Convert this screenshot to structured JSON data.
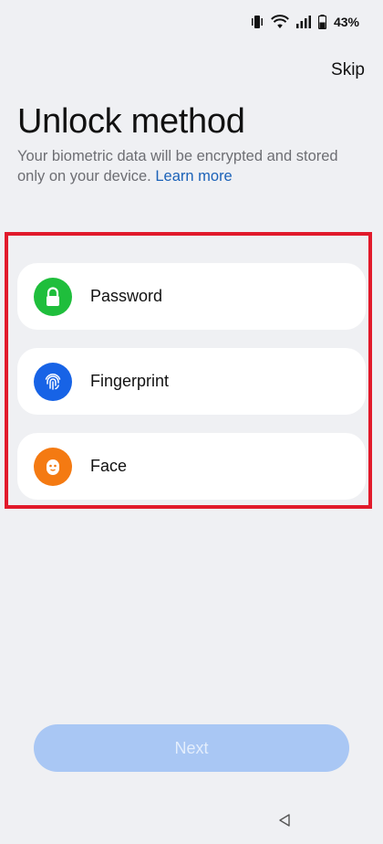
{
  "status_bar": {
    "battery": "43%",
    "icons": [
      "vibrate-icon",
      "wifi-icon",
      "signal-icon",
      "battery-icon"
    ]
  },
  "header": {
    "skip_label": "Skip",
    "title": "Unlock method",
    "subtitle": "Your biometric data will be encrypted and stored only on your device.",
    "learn_more": "Learn more"
  },
  "options": [
    {
      "label": "Password",
      "icon": "lock-icon",
      "color": "#1fbe3c"
    },
    {
      "label": "Fingerprint",
      "icon": "fingerprint-icon",
      "color": "#1763e6"
    },
    {
      "label": "Face",
      "icon": "face-icon",
      "color": "#f47a12"
    }
  ],
  "footer": {
    "next_label": "Next"
  },
  "colors": {
    "background": "#eff0f3",
    "highlight": "#e11a2b",
    "link": "#1b62b8",
    "next_button": "#a9c7f4"
  }
}
